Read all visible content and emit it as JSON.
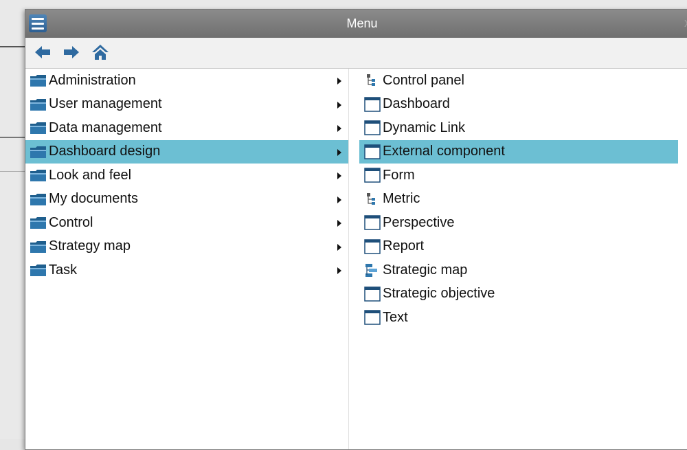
{
  "window": {
    "title": "Menu",
    "close": "x"
  },
  "toolbar": {
    "back_icon": "arrow-left-icon",
    "forward_icon": "arrow-right-icon",
    "home_icon": "home-icon"
  },
  "categories": [
    {
      "label": "Administration",
      "icon": "folder-icon"
    },
    {
      "label": "User management",
      "icon": "folder-icon"
    },
    {
      "label": "Data management",
      "icon": "folder-icon"
    },
    {
      "label": "Dashboard design",
      "icon": "folder-icon",
      "selected": true
    },
    {
      "label": "Look and feel",
      "icon": "folder-icon"
    },
    {
      "label": "My documents",
      "icon": "folder-icon"
    },
    {
      "label": "Control",
      "icon": "folder-icon"
    },
    {
      "label": "Strategy map",
      "icon": "folder-icon"
    },
    {
      "label": "Task",
      "icon": "folder-icon"
    }
  ],
  "items": [
    {
      "label": "Control panel",
      "icon": "tree-icon"
    },
    {
      "label": "Dashboard",
      "icon": "window-icon"
    },
    {
      "label": "Dynamic Link",
      "icon": "window-icon"
    },
    {
      "label": "External component",
      "icon": "window-icon",
      "selected": true
    },
    {
      "label": "Form",
      "icon": "window-icon"
    },
    {
      "label": "Metric",
      "icon": "tree-icon"
    },
    {
      "label": "Perspective",
      "icon": "window-icon"
    },
    {
      "label": "Report",
      "icon": "window-icon"
    },
    {
      "label": "Strategic map",
      "icon": "hierarchy-icon"
    },
    {
      "label": "Strategic objective",
      "icon": "window-icon"
    },
    {
      "label": "Text",
      "icon": "window-icon"
    }
  ],
  "colors": {
    "selection": "#6cbfd3",
    "titlebar": "#7c7c7c",
    "folder": "#2e6e9e",
    "accent_blue": "#2f6aa0"
  }
}
